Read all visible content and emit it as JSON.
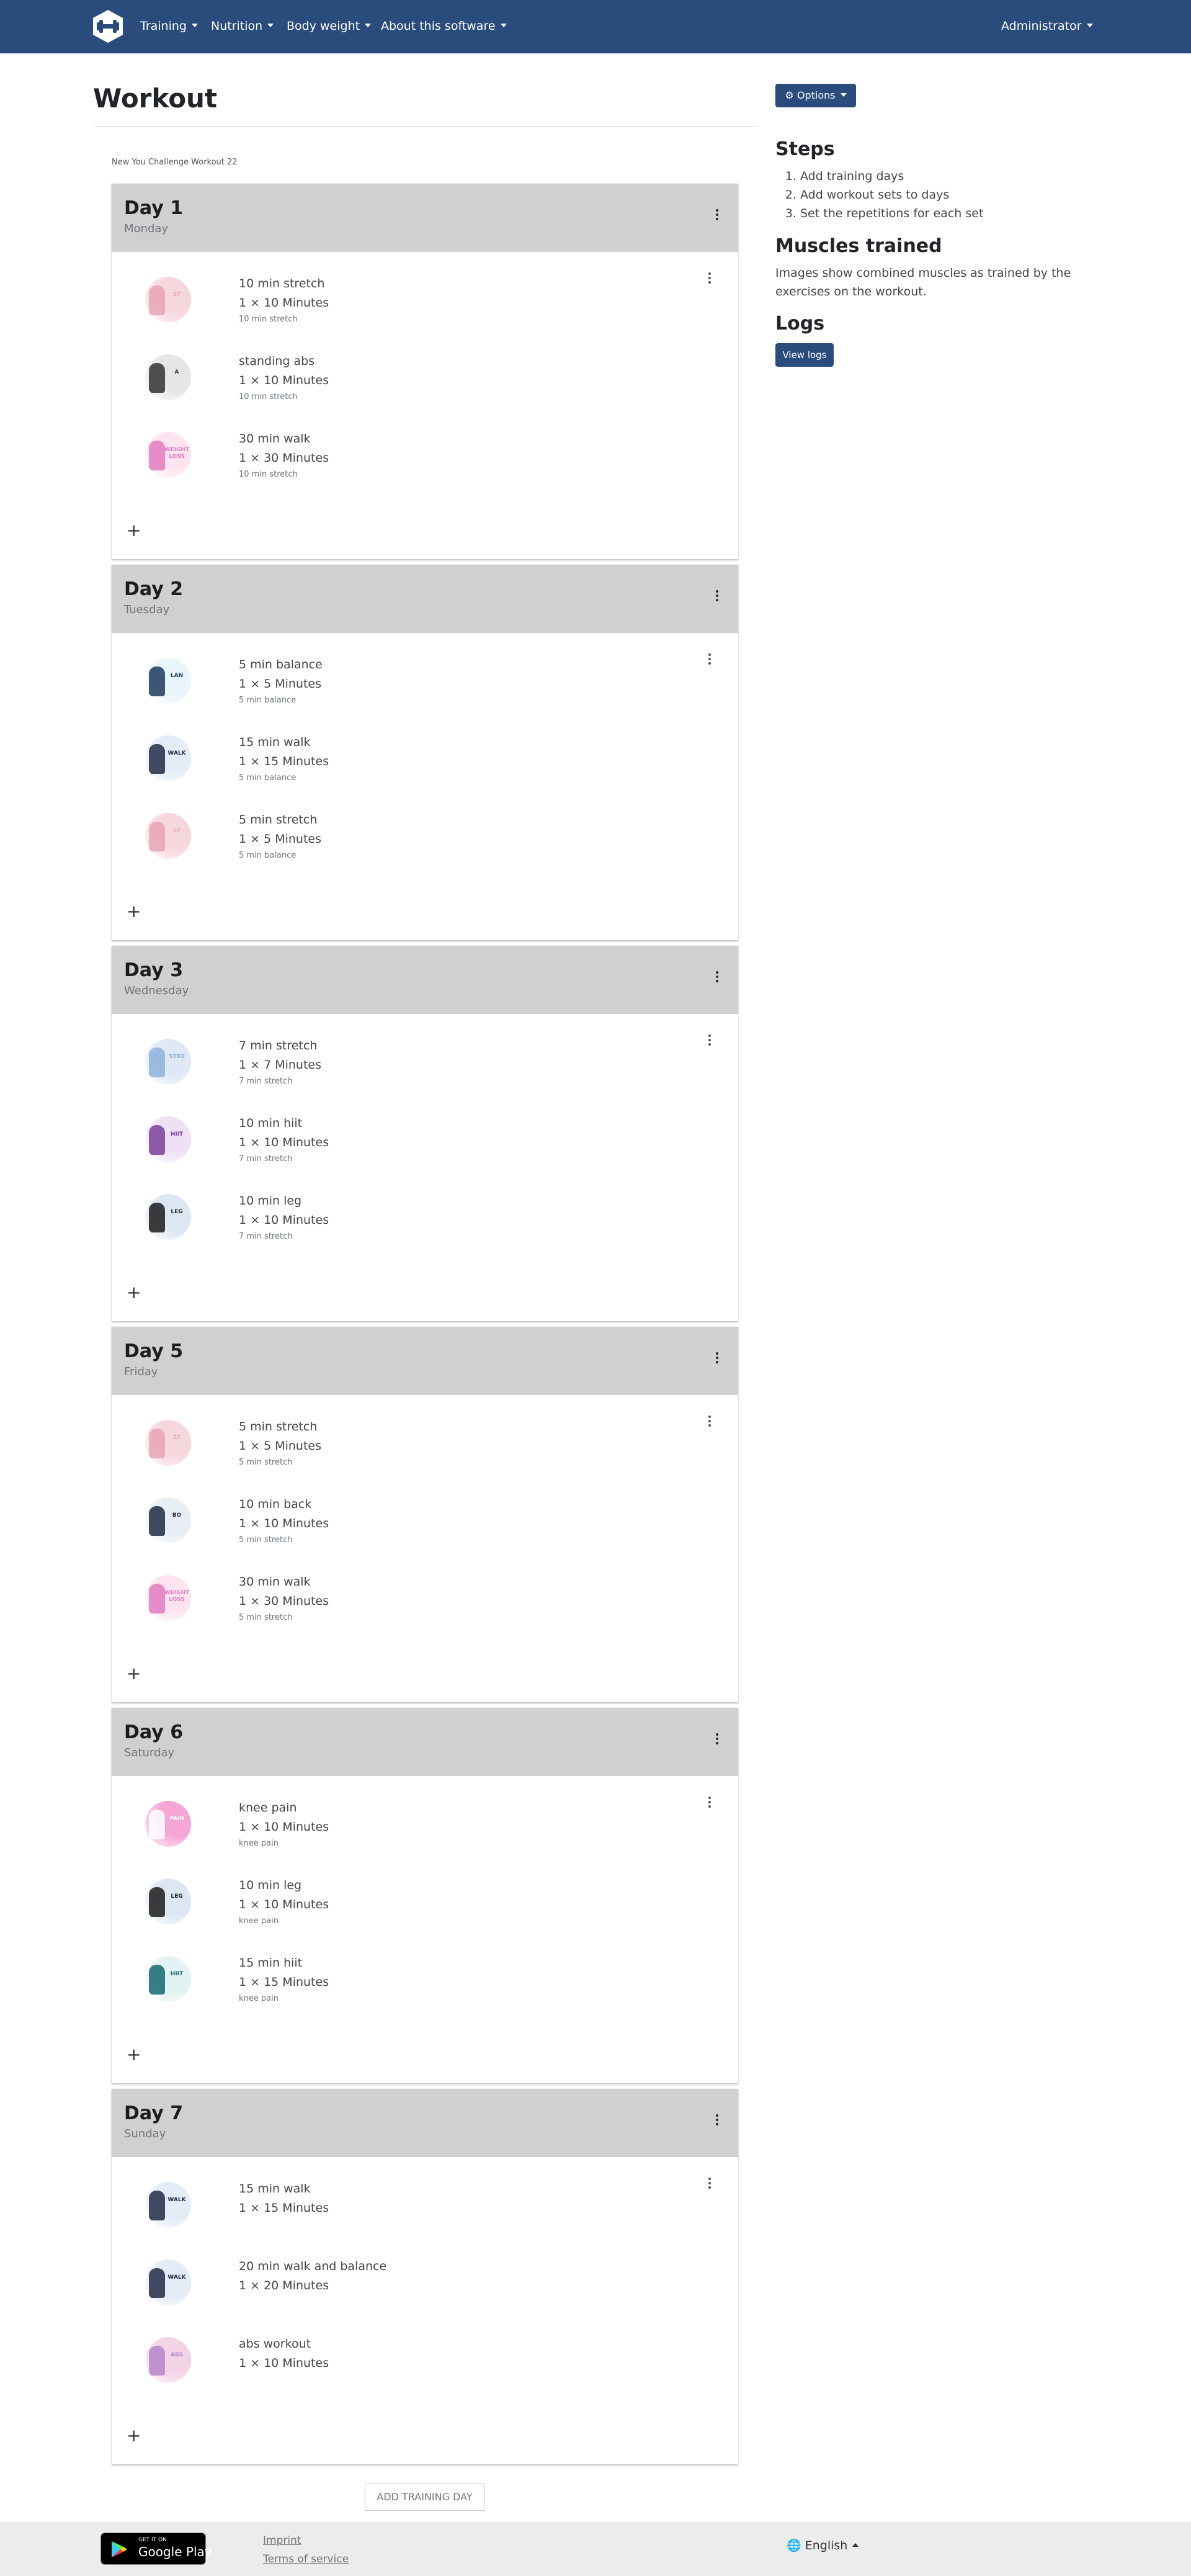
{
  "nav": {
    "items": [
      "Training",
      "Nutrition",
      "Body weight",
      "About this software"
    ],
    "user": "Administrator"
  },
  "page": {
    "title": "Workout",
    "plan_description": "New You Challenge Workout 22"
  },
  "days": [
    {
      "title": "Day 1",
      "weekday": "Monday",
      "exercises": [
        {
          "name": "10 min stretch",
          "sets": "1 × 10 Minutes",
          "note": "10 min stretch",
          "thumb": "stretch",
          "thumb_text": "ST"
        },
        {
          "name": "standing abs",
          "sets": "1 × 10 Minutes",
          "note": "10 min stretch",
          "thumb": "abs",
          "thumb_text": "A"
        },
        {
          "name": "30 min walk",
          "sets": "1 × 30 Minutes",
          "note": "10 min stretch",
          "thumb": "walk-pink",
          "thumb_text": "WEIGHT LOSS"
        }
      ]
    },
    {
      "title": "Day 2",
      "weekday": "Tuesday",
      "exercises": [
        {
          "name": "5 min balance",
          "sets": "1 × 5 Minutes",
          "note": "5 min balance",
          "thumb": "balance",
          "thumb_text": "LAN"
        },
        {
          "name": "15 min walk",
          "sets": "1 × 15 Minutes",
          "note": "5 min balance",
          "thumb": "walk-blue",
          "thumb_text": "WALK"
        },
        {
          "name": "5 min stretch",
          "sets": "1 × 5 Minutes",
          "note": "5 min balance",
          "thumb": "stretch",
          "thumb_text": "ST"
        }
      ]
    },
    {
      "title": "Day 3",
      "weekday": "Wednesday",
      "exercises": [
        {
          "name": "7 min stretch",
          "sets": "1 × 7 Minutes",
          "note": "7 min stretch",
          "thumb": "stretch-blue",
          "thumb_text": "STRE"
        },
        {
          "name": "10 min hiit",
          "sets": "1 × 10 Minutes",
          "note": "7 min stretch",
          "thumb": "hiit-purple",
          "thumb_text": "HIIT"
        },
        {
          "name": "10 min leg",
          "sets": "1 × 10 Minutes",
          "note": "7 min stretch",
          "thumb": "leg",
          "thumb_text": "LEG"
        }
      ]
    },
    {
      "title": "Day 5",
      "weekday": "Friday",
      "exercises": [
        {
          "name": "5 min stretch",
          "sets": "1 × 5 Minutes",
          "note": "5 min stretch",
          "thumb": "stretch",
          "thumb_text": "ST"
        },
        {
          "name": "10 min back",
          "sets": "1 × 10 Minutes",
          "note": "5 min stretch",
          "thumb": "back",
          "thumb_text": "BO"
        },
        {
          "name": "30 min walk",
          "sets": "1 × 30 Minutes",
          "note": "5 min stretch",
          "thumb": "walk-pink",
          "thumb_text": "WEIGHT LOSS"
        }
      ]
    },
    {
      "title": "Day 6",
      "weekday": "Saturday",
      "exercises": [
        {
          "name": "knee pain",
          "sets": "1 × 10 Minutes",
          "note": "knee pain",
          "thumb": "knee",
          "thumb_text": "PAIN"
        },
        {
          "name": "10 min leg",
          "sets": "1 × 10 Minutes",
          "note": "knee pain",
          "thumb": "leg",
          "thumb_text": "LEG"
        },
        {
          "name": "15 min hiit",
          "sets": "1 × 15 Minutes",
          "note": "knee pain",
          "thumb": "hiit-teal",
          "thumb_text": "HIIT"
        }
      ]
    },
    {
      "title": "Day 7",
      "weekday": "Sunday",
      "exercises": [
        {
          "name": "15 min walk",
          "sets": "1 × 15 Minutes",
          "note": "",
          "thumb": "walk-blue",
          "thumb_text": "WALK"
        },
        {
          "name": "20 min walk and balance",
          "sets": "1 × 20 Minutes",
          "note": "",
          "thumb": "walk-blue",
          "thumb_text": "WALK"
        },
        {
          "name": "abs workout",
          "sets": "1 × 10 Minutes",
          "note": "",
          "thumb": "abs-pink",
          "thumb_text": "ABS"
        }
      ]
    }
  ],
  "add_day_label": "ADD TRAINING DAY",
  "sidebar": {
    "options_label": "Options",
    "steps_title": "Steps",
    "steps": [
      "Add training days",
      "Add workout sets to days",
      "Set the repetitions for each set"
    ],
    "muscles_title": "Muscles trained",
    "muscles_text": "Images show combined muscles as trained by the exercises on the workout.",
    "logs_title": "Logs",
    "logs_button": "View logs"
  },
  "footer": {
    "store_small": "GET IT ON",
    "store_big": "Google Play",
    "imprint": "Imprint",
    "terms": "Terms of service",
    "language": "English"
  },
  "colors": {
    "navbar": "#2a4c7d",
    "day_header": "#d0d0d0",
    "footer": "#ececec"
  }
}
